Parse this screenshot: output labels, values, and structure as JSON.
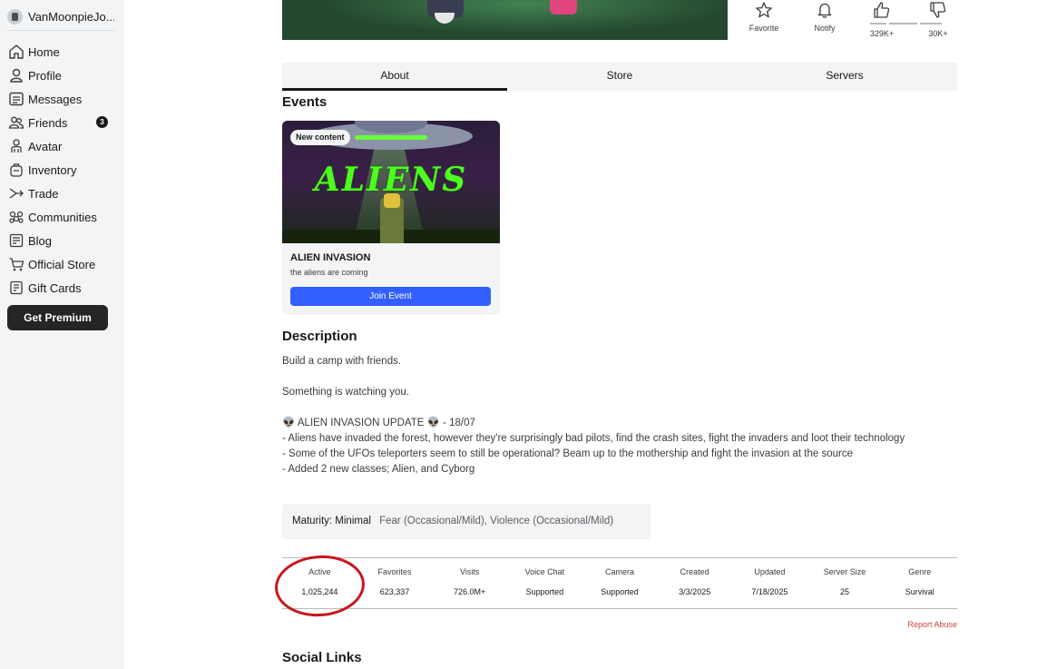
{
  "sidebar": {
    "username": "VanMoonpieJo...",
    "items": [
      {
        "label": "Home",
        "icon": "home-icon"
      },
      {
        "label": "Profile",
        "icon": "profile-icon"
      },
      {
        "label": "Messages",
        "icon": "messages-icon"
      },
      {
        "label": "Friends",
        "icon": "friends-icon",
        "badge": "3"
      },
      {
        "label": "Avatar",
        "icon": "avatar-icon"
      },
      {
        "label": "Inventory",
        "icon": "inventory-icon"
      },
      {
        "label": "Trade",
        "icon": "trade-icon"
      },
      {
        "label": "Communities",
        "icon": "communities-icon"
      },
      {
        "label": "Blog",
        "icon": "blog-icon"
      },
      {
        "label": "Official Store",
        "icon": "cart-icon"
      },
      {
        "label": "Gift Cards",
        "icon": "gift-card-icon"
      }
    ],
    "premium_label": "Get Premium"
  },
  "actions": {
    "favorite_label": "Favorite",
    "notify_label": "Notify",
    "upvotes": "329K+",
    "downvotes": "30K+"
  },
  "tabs": [
    "About",
    "Store",
    "Servers"
  ],
  "events": {
    "title": "Events",
    "card": {
      "badge": "New content",
      "image_text": "ALIENS",
      "name": "ALIEN INVASION",
      "subtitle": "the aliens are coming",
      "button": "Join Event"
    }
  },
  "description": {
    "title": "Description",
    "lines": [
      "Build a camp with friends.",
      "",
      "Something is watching you.",
      "",
      "👽 ALIEN INVASION UPDATE 👽 - 18/07",
      " - Aliens have invaded the forest, however they're surprisingly bad pilots, find the crash sites, fight the invaders and loot their technology",
      " - Some of the UFOs teleporters seem to still be operational? Beam up to the mothership and fight the invasion at the source",
      " - Added 2 new classes; Alien, and Cyborg"
    ]
  },
  "maturity": {
    "label": "Maturity: Minimal",
    "descriptors": "Fear (Occasional/Mild), Violence (Occasional/Mild)"
  },
  "stats": [
    {
      "label": "Active",
      "value": "1,025,244"
    },
    {
      "label": "Favorites",
      "value": "623,337"
    },
    {
      "label": "Visits",
      "value": "726.0M+"
    },
    {
      "label": "Voice Chat",
      "value": "Supported"
    },
    {
      "label": "Camera",
      "value": "Supported"
    },
    {
      "label": "Created",
      "value": "3/3/2025"
    },
    {
      "label": "Updated",
      "value": "7/18/2025"
    },
    {
      "label": "Server Size",
      "value": "25"
    },
    {
      "label": "Genre",
      "value": "Survival"
    }
  ],
  "report_label": "Report Abuse",
  "social_title": "Social Links",
  "colors": {
    "accent_blue": "#335fff",
    "annotation_red": "#c8161d",
    "report_red": "#d43f3a"
  }
}
